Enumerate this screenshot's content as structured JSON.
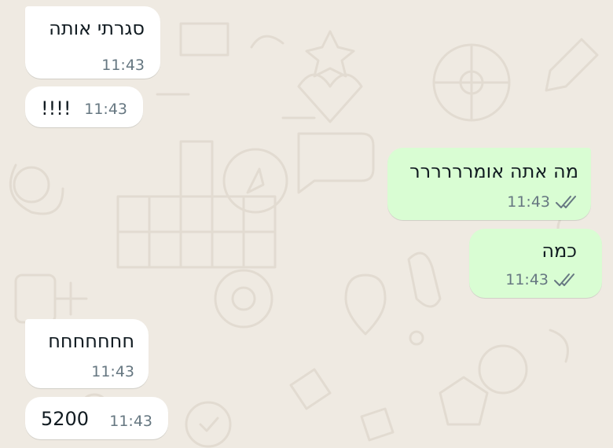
{
  "chat": {
    "messages": [
      {
        "direction": "incoming",
        "text": "סגרתי אותה",
        "time": "11:43"
      },
      {
        "direction": "incoming",
        "text": "!!!!",
        "time": "11:43"
      },
      {
        "direction": "outgoing",
        "text": "מה אתה אומרררררר",
        "time": "11:43",
        "status_icon": "double-check-icon"
      },
      {
        "direction": "outgoing",
        "text": "כמה",
        "time": "11:43",
        "status_icon": "double-check-icon"
      },
      {
        "direction": "incoming",
        "text": "חחחחחחח",
        "time": "11:43"
      },
      {
        "direction": "incoming",
        "text": "5200",
        "time": "11:43"
      }
    ]
  },
  "colors": {
    "wallpaper": "#efeae2",
    "incoming_bubble": "#ffffff",
    "outgoing_bubble": "#d9fdd3",
    "timestamp": "#667781",
    "tick": "#667781"
  }
}
